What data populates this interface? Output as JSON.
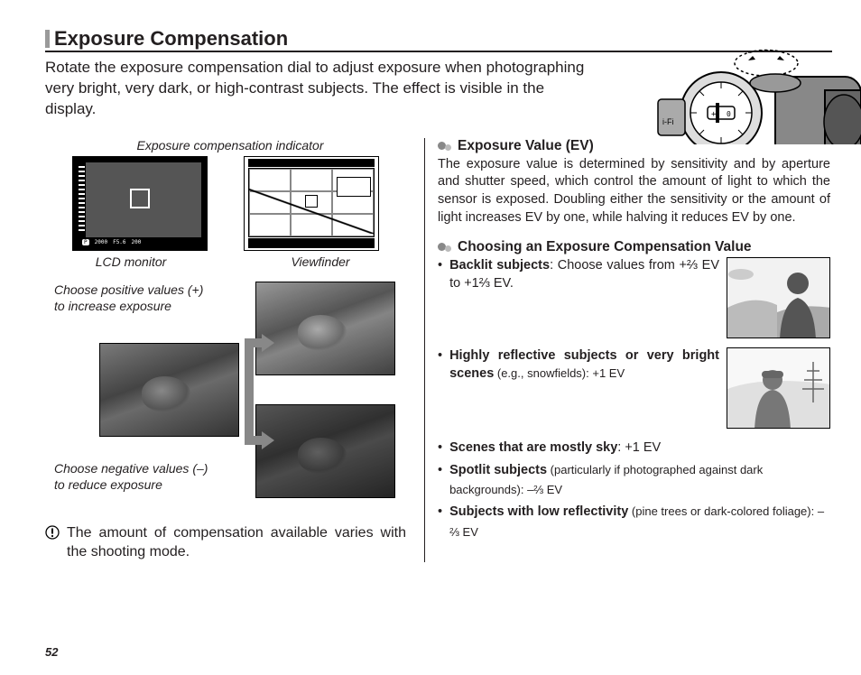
{
  "section": {
    "title": "Exposure Compensation"
  },
  "intro": "Rotate the exposure compensation dial to adjust exposure when photographing very bright, very dark, or high-contrast subjects.  The effect is visible in the display.",
  "left": {
    "indicator_label": "Exposure compensation indicator",
    "lcd": {
      "mode": "P",
      "shutter": "2000",
      "aperture": "F5.6",
      "iso": "200"
    },
    "lcd_caption": "LCD monitor",
    "vf_caption": "Viewfinder",
    "pos_label": "Choose positive values (+) to increase exposure",
    "neg_label": "Choose negative values (–) to reduce exposure",
    "note": "The amount of compensation available varies with the shooting mode."
  },
  "right": {
    "ev_title": "Exposure Value (EV)",
    "ev_body": "The exposure value is determined by sensitivity and by aperture and shutter speed, which control the amount of light to which the sensor is exposed.  Doubling either the sensitivity or the amount of light increases EV by one, while halving it reduces EV by one.",
    "choose_title": "Choosing an Exposure Compensation Value",
    "backlit_label": "Backlit subjects",
    "backlit_text": ": Choose values from +⅔ EV to +1⅔ EV.",
    "reflect_label": "Highly reflective subjects or very bright scenes",
    "reflect_text": " (e.g., snowfields): +1 EV",
    "sky_label": "Scenes that are mostly sky",
    "sky_text": ": +1 EV",
    "spotlit_label": "Spotlit subjects",
    "spotlit_text": " (particularly if photographed against dark backgrounds): –⅔ EV",
    "lowref_label": "Subjects with low reflectivity",
    "lowref_text": " (pine trees or dark-colored foliage): –⅔ EV"
  },
  "page": "52"
}
